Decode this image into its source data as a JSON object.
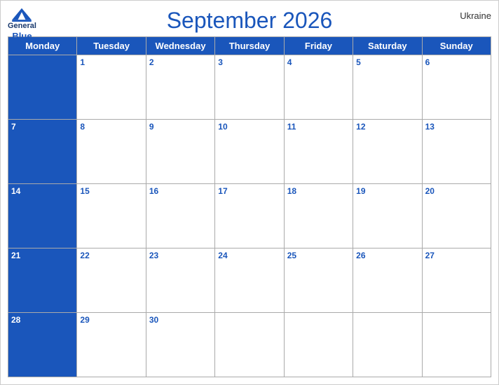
{
  "header": {
    "title": "September 2026",
    "country": "Ukraine",
    "logo_general": "General",
    "logo_blue": "Blue"
  },
  "weekdays": [
    "Monday",
    "Tuesday",
    "Wednesday",
    "Thursday",
    "Friday",
    "Saturday",
    "Sunday"
  ],
  "weeks": [
    [
      null,
      1,
      2,
      3,
      4,
      5,
      6
    ],
    [
      7,
      8,
      9,
      10,
      11,
      12,
      13
    ],
    [
      14,
      15,
      16,
      17,
      18,
      19,
      20
    ],
    [
      21,
      22,
      23,
      24,
      25,
      26,
      27
    ],
    [
      28,
      29,
      30,
      null,
      null,
      null,
      null
    ]
  ],
  "colors": {
    "header_bg": "#1a56bb",
    "header_text": "#ffffff",
    "title_color": "#1a56bb"
  }
}
